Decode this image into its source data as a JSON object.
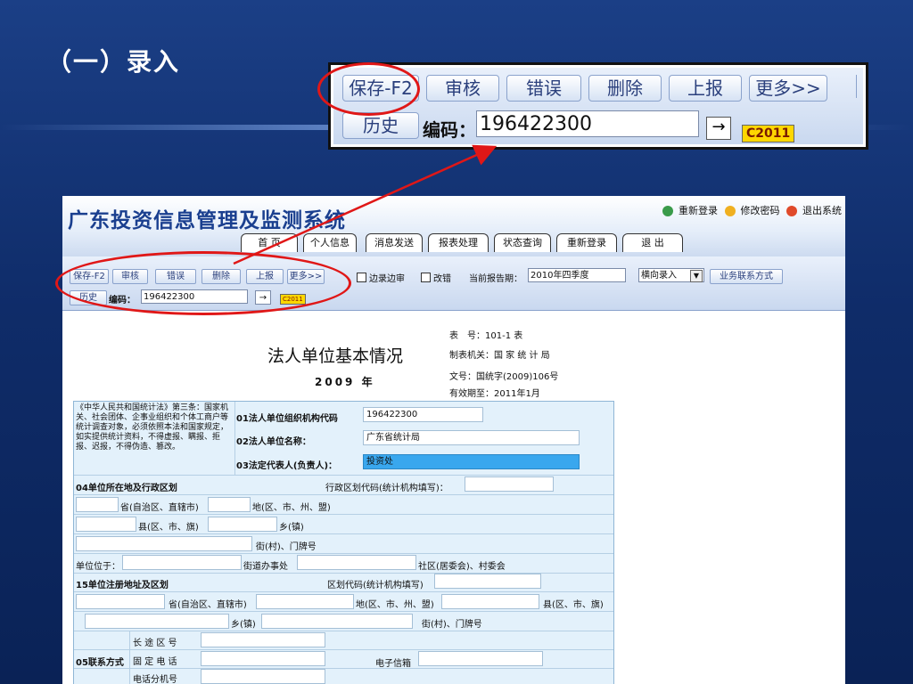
{
  "slide": {
    "title": "（一）录入"
  },
  "zoom": {
    "buttons": [
      "保存-F2",
      "审核",
      "错误",
      "删除",
      "上报",
      "更多>>"
    ],
    "history": "历史",
    "code_label": "编码：",
    "code_value": "196422300",
    "go": "→",
    "year": "C2011"
  },
  "app": {
    "title": "广东投资信息管理及监测系统",
    "top_links": [
      "重新登录",
      "修改密码",
      "退出系统"
    ],
    "nav": [
      "首 页",
      "个人信息",
      "消息发送",
      "报表处理",
      "状态查询",
      "重新登录",
      "退 出"
    ],
    "toolbar": {
      "buttons": [
        "保存-F2",
        "审核",
        "错误",
        "删除",
        "上报",
        "更多>>"
      ],
      "check1": "边录边审",
      "check2": "改错",
      "period_label": "当前报告期：",
      "period_value": "2010年四季度",
      "mode_value": "横向录入",
      "contact": "业务联系方式",
      "history": "历史",
      "code_label": "编码：",
      "code_value": "196422300",
      "go": "→",
      "year": "C2011"
    }
  },
  "form": {
    "title": "法人单位基本情况",
    "year": "2009 年",
    "meta": {
      "table_no": "表　号：101-1 表",
      "authority": "制表机关：国 家 统 计 局",
      "doc_no": "文号：国统字(2009)106号",
      "valid": "有效期至：2011年1月"
    },
    "law_note": "《中华人民共和国统计法》第三条：国家机关、社会团体、企事业组织和个体工商户等统计调查对象，必须依照本法和国家规定，如实提供统计资料，不得虚报、瞒报、拒报、迟报，不得伪造、篡改。",
    "f01_label": "01法人单位组织机构代码",
    "f01_value": "196422300",
    "f02_label": "02法人单位名称：",
    "f02_value": "广东省统计局",
    "f03_label": "03法定代表人(负责人)：",
    "f03_value": "投资处",
    "f04_label": "04单位所在地及行政区划",
    "f04_code_label": "行政区划代码(统计机构填写)：",
    "province": "省(自治区、直辖市)",
    "prefecture": "地(区、市、州、盟)",
    "county": "县(区、市、旗)",
    "township": "乡(镇)",
    "street": "街(村)、门牌号",
    "located_label": "单位位于：",
    "subdistrict": "街道办事处",
    "community": "社区(居委会)、村委会",
    "f15_label": "15单位注册地址及区划",
    "f15_code_label": "区划代码(统计机构填写)",
    "province2": "省(自治区、直辖市)",
    "prefecture2": "地(区、市、州、盟)",
    "county2": "县(区、市、旗)",
    "township2": "乡(镇)",
    "street2": "街(村)、门牌号",
    "f05_label": "05联系方式",
    "long_code": "长 途 区 号",
    "phone": "固 定 电 话",
    "email": "电子信箱",
    "ext": "电话分机号"
  },
  "colors": {
    "annotation": "#e01717",
    "title_blue": "#1a3f8f",
    "highlight": "#39a7ee"
  }
}
